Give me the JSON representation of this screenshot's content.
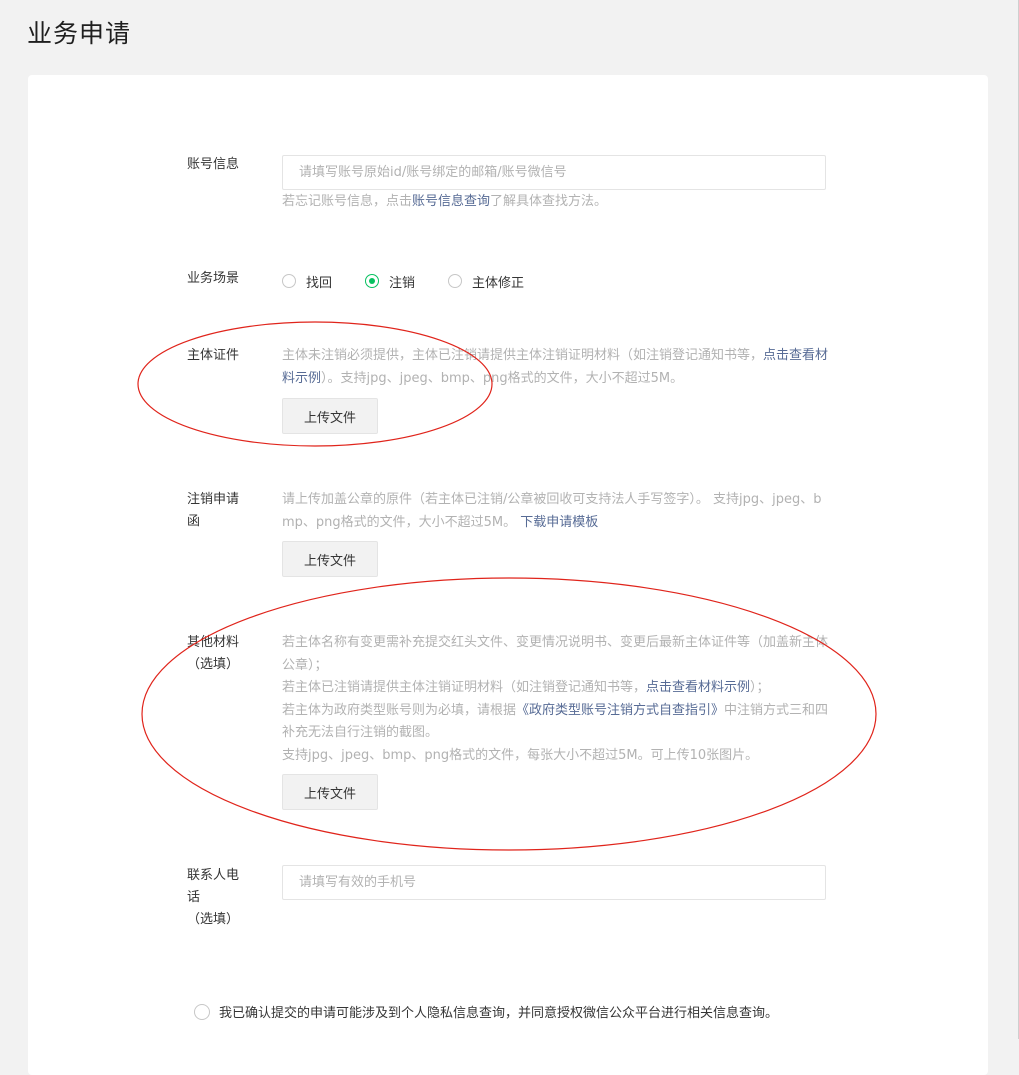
{
  "page": {
    "title": "业务申请"
  },
  "account": {
    "label": "账号信息",
    "placeholder": "请填写账号原始id/账号绑定的邮箱/账号微信号",
    "hint_prefix": "若忘记账号信息，点击",
    "hint_link": "账号信息查询",
    "hint_suffix": "了解具体查找方法。"
  },
  "scenario": {
    "label": "业务场景",
    "options": [
      {
        "label": "找回",
        "checked": false
      },
      {
        "label": "注销",
        "checked": true
      },
      {
        "label": "主体修正",
        "checked": false
      }
    ]
  },
  "certificate": {
    "label": "主体证件",
    "hint_text": "主体未注销必须提供，主体已注销请提供主体注销证明材料（如注销登记通知书等，",
    "hint_link": "点击查看材料示例",
    "hint_suffix": "）。支持jpg、jpeg、bmp、png格式的文件，大小不超过5M。",
    "upload_label": "上传文件"
  },
  "cancel_letter": {
    "label": "注销申请函",
    "hint_text": "请上传加盖公章的原件（若主体已注销/公章被回收可支持法人手写签字）。 支持jpg、jpeg、bmp、png格式的文件，大小不超过5M。 ",
    "hint_link": "下载申请模板",
    "upload_label": "上传文件"
  },
  "other": {
    "label_line1": "其他材料",
    "label_line2": "（选填）",
    "line1": "若主体名称有变更需补充提交红头文件、变更情况说明书、变更后最新主体证件等（加盖新主体公章）；",
    "line2_text": "若主体已注销请提供主体注销证明材料（如注销登记通知书等，",
    "line2_link": "点击查看材料示例",
    "line2_suffix": "）；",
    "line3_text": "若主体为政府类型账号则为必填，请根据",
    "line3_link": "《政府类型账号注销方式自查指引》",
    "line3_suffix": "中注销方式三和四补充无法自行注销的截图。",
    "line4": "支持jpg、jpeg、bmp、png格式的文件，每张大小不超过5M。可上传10张图片。",
    "upload_label": "上传文件"
  },
  "contact": {
    "label_line1": "联系人电话",
    "label_line2": "（选填）",
    "placeholder": "请填写有效的手机号"
  },
  "confirm": {
    "text": "我已确认提交的申请可能涉及到个人隐私信息查询，并同意授权微信公众平台进行相关信息查询。"
  },
  "colors": {
    "accent": "#07c160",
    "link": "#576b95",
    "hint": "#b2b2b2",
    "annotation": "#e0241b"
  }
}
